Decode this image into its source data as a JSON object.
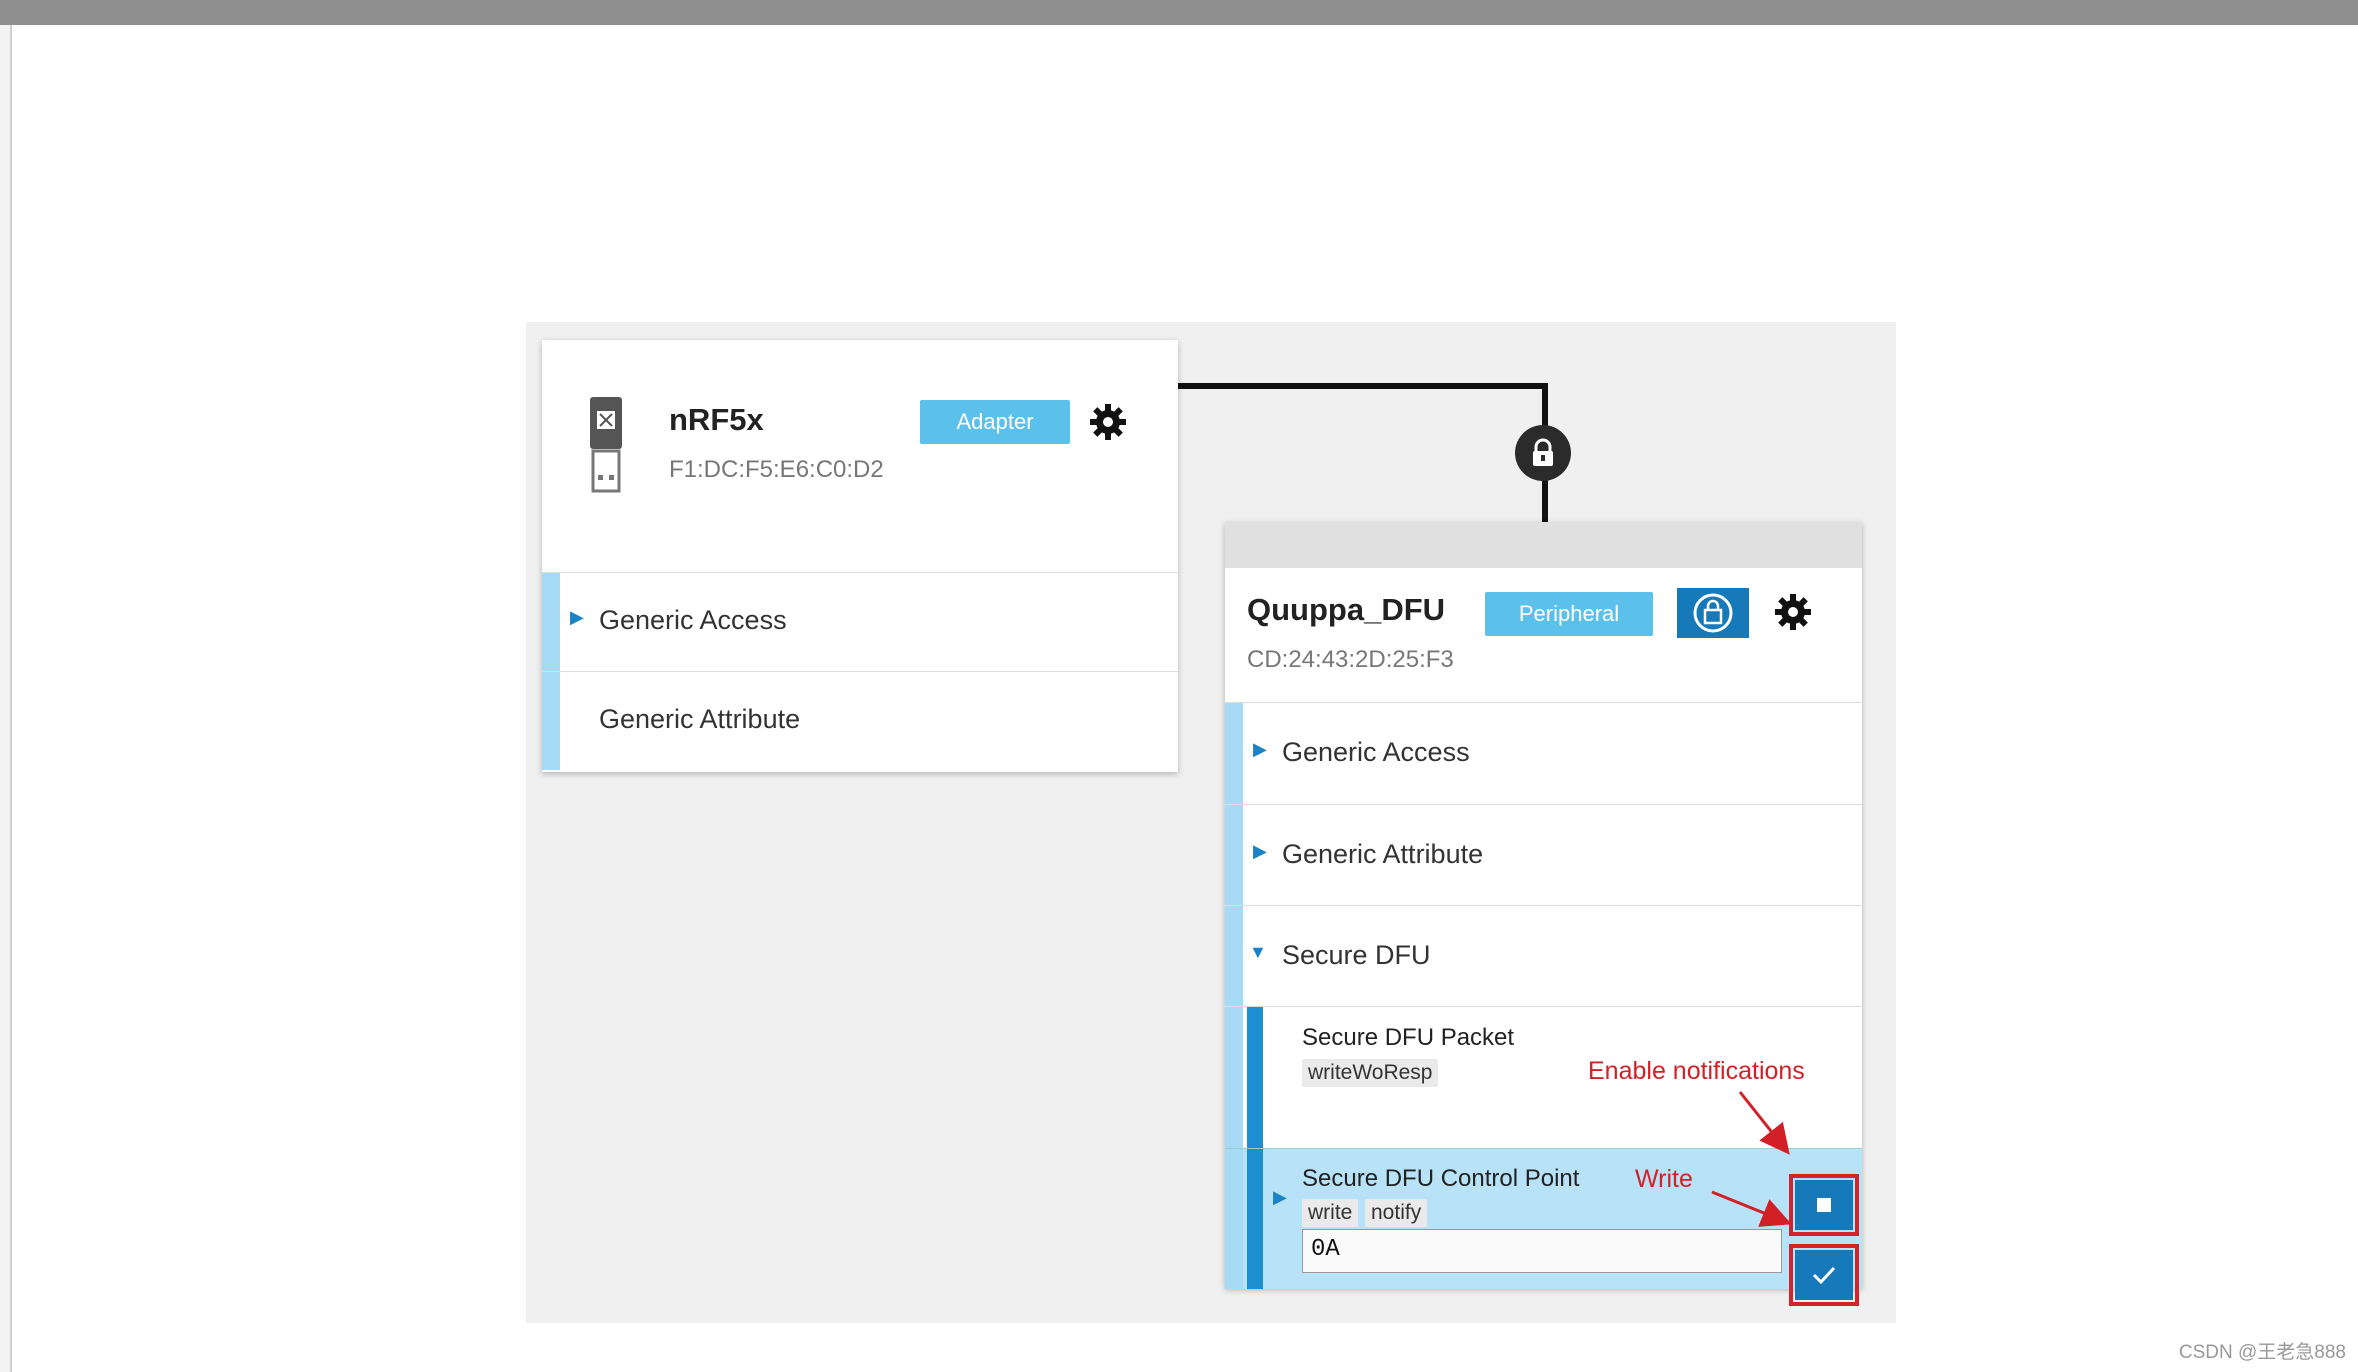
{
  "adapter": {
    "name": "nRF5x",
    "address": "F1:DC:F5:E6:C0:D2",
    "badge": "Adapter",
    "services": [
      "Generic Access",
      "Generic Attribute"
    ]
  },
  "peripheral": {
    "name": "Quuppa_DFU",
    "address": "CD:24:43:2D:25:F3",
    "badge": "Peripheral",
    "services": [
      "Generic Access",
      "Generic Attribute",
      "Secure DFU"
    ],
    "characteristics": [
      {
        "name": "Secure DFU Packet",
        "properties": [
          "writeWoResp"
        ]
      },
      {
        "name": "Secure DFU Control Point",
        "properties": [
          "write",
          "notify"
        ],
        "value": "0A"
      }
    ]
  },
  "annotations": {
    "enable_notifications": "Enable notifications",
    "write": "Write"
  },
  "watermark": "CSDN @王老急888",
  "colors": {
    "accent": "#5bc0ea",
    "button": "#1679b9",
    "annotation": "#d32027",
    "stripe": "#a7daf4"
  }
}
